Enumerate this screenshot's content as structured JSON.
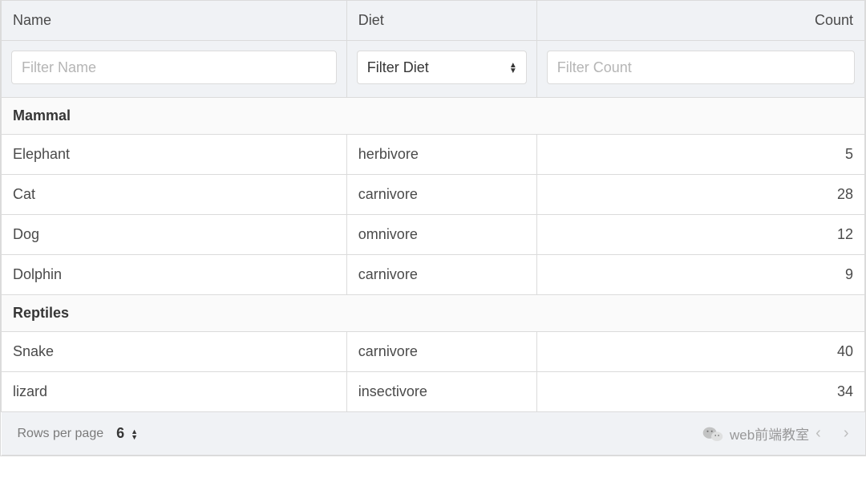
{
  "columns": {
    "name": {
      "label": "Name",
      "filter_placeholder": "Filter Name"
    },
    "diet": {
      "label": "Diet",
      "filter_placeholder": "Filter Diet"
    },
    "count": {
      "label": "Count",
      "filter_placeholder": "Filter Count"
    }
  },
  "groups": [
    {
      "title": "Mammal",
      "rows": [
        {
          "name": "Elephant",
          "diet": "herbivore",
          "count": "5"
        },
        {
          "name": "Cat",
          "diet": "carnivore",
          "count": "28"
        },
        {
          "name": "Dog",
          "diet": "omnivore",
          "count": "12"
        },
        {
          "name": "Dolphin",
          "diet": "carnivore",
          "count": "9"
        }
      ]
    },
    {
      "title": "Reptiles",
      "rows": [
        {
          "name": "Snake",
          "diet": "carnivore",
          "count": "40"
        },
        {
          "name": "lizard",
          "diet": "insectivore",
          "count": "34"
        }
      ]
    }
  ],
  "footer": {
    "rows_per_page_label": "Rows per page",
    "rows_per_page_value": "6"
  },
  "watermark": {
    "text": "web前端教室"
  }
}
